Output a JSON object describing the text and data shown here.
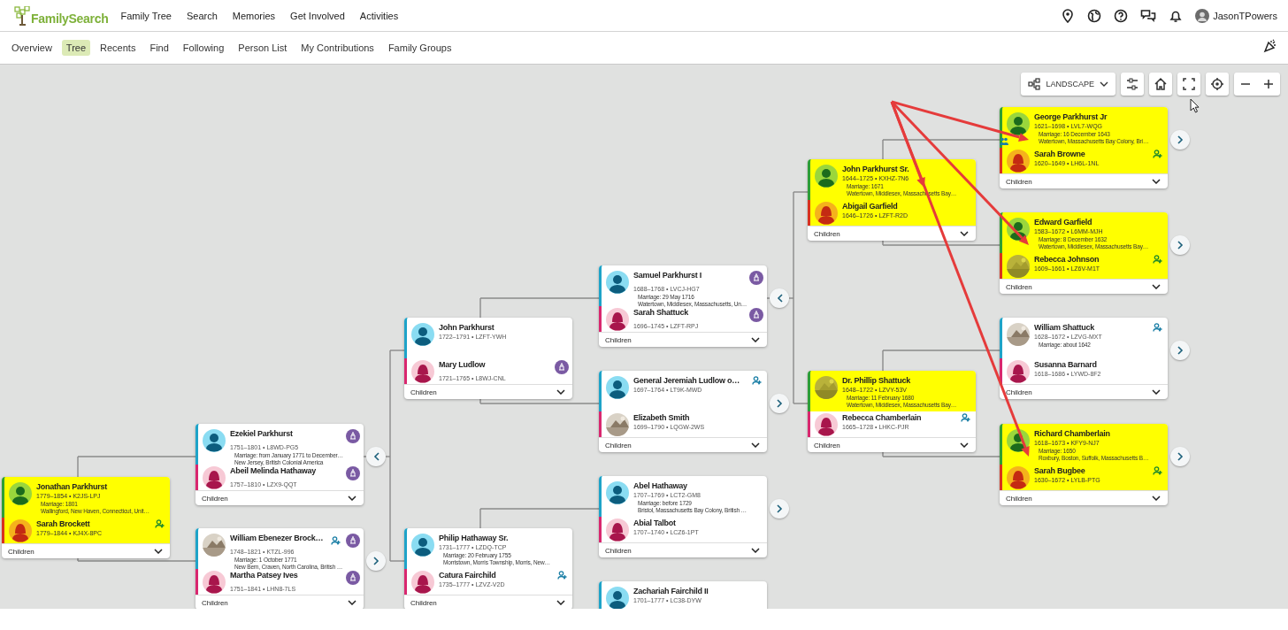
{
  "header": {
    "logo": "FamilySearch",
    "nav": [
      {
        "label": "Family Tree"
      },
      {
        "label": "Search"
      },
      {
        "label": "Memories"
      },
      {
        "label": "Get Involved"
      },
      {
        "label": "Activities"
      }
    ],
    "user": "JasonTPowers"
  },
  "subnav": [
    {
      "label": "Overview",
      "selected": false
    },
    {
      "label": "Tree",
      "selected": true
    },
    {
      "label": "Recents",
      "selected": false
    },
    {
      "label": "Find",
      "selected": false
    },
    {
      "label": "Following",
      "selected": false
    },
    {
      "label": "Person List",
      "selected": false
    },
    {
      "label": "My Contributions",
      "selected": false
    },
    {
      "label": "Family Groups",
      "selected": false
    }
  ],
  "toolbar": {
    "layout": "LANDSCAPE"
  },
  "tree": {
    "husband": {
      "name": "Jonathan Parkhurst",
      "dates": "1779–1854 • K2JS-LPJ",
      "kind": "male",
      "highlighted": true
    },
    "wife": {
      "name": "Sarah Brockett",
      "dates": "1779–1844 • KJ4X-8PC",
      "kind": "female",
      "highlighted": true,
      "relatives_icon": true
    },
    "marriage": {
      "date": "Marriage: 1801",
      "place": "Wallingford, New Haven, Connecticut, Unit…"
    },
    "children_label": "Children",
    "parents": [
      {
        "husband": {
          "name": "Ezekiel Parkhurst",
          "dates": "1751–1801 • L8WD-PG5",
          "kind": "male",
          "highlighted": false,
          "temple_icon": true
        },
        "wife": {
          "name": "Abeil Melinda Hathaway",
          "dates": "1757–1810 • LZX9-QQT",
          "kind": "female",
          "highlighted": false,
          "temple_icon": true
        },
        "marriage": {
          "date": "Marriage: from January 1771 to December…",
          "place": "New Jersey, British Colonial America"
        },
        "children_label": "Children",
        "collapse_button": true,
        "parents": [
          {
            "husband": {
              "name": "John Parkhurst",
              "dates": "1722–1791 • LZFT-YWH",
              "kind": "male",
              "highlighted": false
            },
            "wife": {
              "name": "Mary Ludlow",
              "dates": "1721–1765 • L8WJ-CNL",
              "kind": "female",
              "highlighted": false,
              "temple_icon": true
            },
            "children_label": "Children",
            "parents": [
              {
                "husband": {
                  "name": "Samuel Parkhurst I",
                  "dates": "1688–1768 • LVCJ-HG7",
                  "kind": "male",
                  "highlighted": false,
                  "temple_icon": true
                },
                "wife": {
                  "name": "Sarah Shattuck",
                  "dates": "1696–1745 • LZFT-RPJ",
                  "kind": "female",
                  "highlighted": false,
                  "temple_icon": true
                },
                "marriage": {
                  "date": "Marriage: 29 May 1716",
                  "place": "Watertown, Middlesex, Massachusetts, Un…"
                },
                "children_label": "Children",
                "collapse_button": true,
                "parents": [
                  {
                    "husband": {
                      "name": "John Parkhurst Sr.",
                      "dates": "1644–1725 • KXHZ-7N6",
                      "kind": "male",
                      "highlighted": true
                    },
                    "wife": {
                      "name": "Abigail Garfield",
                      "dates": "1646–1726 • LZFT-R2D",
                      "kind": "female",
                      "highlighted": true
                    },
                    "marriage": {
                      "date": "Marriage: 1671",
                      "place": "Watertown, Middlesex, Massachusetts Bay…"
                    },
                    "children_label": "Children",
                    "arrow": true,
                    "parents": [
                      {
                        "husband": {
                          "name": "George Parkhurst Jr",
                          "dates": "1621–1698 • LVL7-WQG",
                          "kind": "male",
                          "highlighted": true
                        },
                        "wife": {
                          "name": "Sarah Browne",
                          "dates": "1620–1649 • LH6L-1NL",
                          "kind": "female",
                          "highlighted": true,
                          "relatives_icon": true
                        },
                        "marriage": {
                          "date": "Marriage: 16 December 1643",
                          "place": "Watertown, Massachusetts Bay Colony, Bri…"
                        },
                        "children_label": "Children",
                        "expand_button": true,
                        "arrow": true,
                        "couple_icon": true
                      },
                      {
                        "husband": {
                          "name": "Edward Garfield",
                          "dates": "1583–1672 • L6MM-MJH",
                          "kind": "male",
                          "highlighted": true
                        },
                        "wife": {
                          "name": "Rebecca Johnson",
                          "dates": "1609–1661 • LZ6V-M1T",
                          "highlighted": true,
                          "relatives_icon": true
                        },
                        "marriage": {
                          "date": "Marriage: 8 December 1632",
                          "place": "Watertown, Middlesex, Massachusetts Bay…"
                        },
                        "children_label": "Children",
                        "expand_button": true,
                        "arrow": true
                      }
                    ]
                  },
                  {
                    "husband": {
                      "name": "Dr. Phillip Shattuck",
                      "dates": "1648–1722 • LZVY-53V",
                      "highlighted": true
                    },
                    "wife": {
                      "name": "Rebecca Chamberlain",
                      "dates": "1665–1728 • LHKC-PJR",
                      "kind": "female",
                      "highlighted": false,
                      "relatives_icon": true
                    },
                    "marriage": {
                      "date": "Marriage: 11 February 1680",
                      "place": "Watertown, Middlesex, Massachusetts Bay…"
                    },
                    "children_label": "Children",
                    "parents": [
                      {
                        "husband": {
                          "name": "William Shattuck",
                          "dates": "1628–1672 • LZVG-MXT",
                          "highlighted": false,
                          "relatives_icon": true
                        },
                        "wife": {
                          "name": "Susanna Barnard",
                          "dates": "1618–1686 • LYWD-8F2",
                          "kind": "female",
                          "highlighted": false
                        },
                        "marriage": {
                          "date": "Marriage: about 1642"
                        },
                        "children_label": "Children",
                        "expand_button": true
                      },
                      {
                        "husband": {
                          "name": "Richard Chamberlain",
                          "dates": "1618–1673 • KFY9-NJ7",
                          "kind": "male",
                          "highlighted": true
                        },
                        "wife": {
                          "name": "Sarah Bugbee",
                          "dates": "1630–1672 • LYLB-PTG",
                          "kind": "female",
                          "highlighted": true,
                          "relatives_icon": true
                        },
                        "marriage": {
                          "date": "Marriage: 1650",
                          "place": "Roxbury, Boston, Suffolk, Massachusetts B…"
                        },
                        "children_label": "Children",
                        "expand_button": true,
                        "arrow": true
                      }
                    ]
                  }
                ]
              },
              {
                "husband": {
                  "name": "General Jeremiah Ludlow o…",
                  "dates": "1697–1764 • LT9K-MWD",
                  "kind": "male",
                  "highlighted": false,
                  "relatives_icon": true
                },
                "wife": {
                  "name": "Elizabeth Smith",
                  "dates": "1699–1790 • LQGW-2WS",
                  "highlighted": false
                },
                "children_label": "Children",
                "expand_button": true
              }
            ]
          },
          {
            "husband": {
              "name": "Philip Hathaway Sr.",
              "dates": "1731–1777 • LZDQ-TCP",
              "kind": "male",
              "highlighted": false
            },
            "wife": {
              "name": "Catura Fairchild",
              "dates": "1735–1777 • LZVZ-V2D",
              "kind": "female",
              "highlighted": false,
              "relatives_icon": true
            },
            "marriage": {
              "date": "Marriage: 20 February 1755",
              "place": "Morristown, Morris Township, Morris, New…"
            },
            "children_label": "Children",
            "parents": [
              {
                "husband": {
                  "name": "Abel Hathaway",
                  "dates": "1707–1769 • LCT2-GM8",
                  "kind": "male",
                  "highlighted": false
                },
                "wife": {
                  "name": "Abial Talbot",
                  "dates": "1707–1740 • LCZ6-1PT",
                  "kind": "female",
                  "highlighted": false
                },
                "marriage": {
                  "date": "Marriage: before 1729",
                  "place": "Bristol, Massachusetts Bay Colony, British …"
                },
                "children_label": "Children",
                "expand_button": true
              },
              {
                "husband": {
                  "name": "Zachariah Fairchild II",
                  "dates": "1701–1777 • LC38-DYW",
                  "kind": "male",
                  "highlighted": false
                }
              }
            ]
          }
        ]
      },
      {
        "husband": {
          "name": "William Ebenezer Brock…",
          "dates": "1748–1821 • KTZL-996",
          "highlighted": false,
          "relatives_icon": true,
          "temple_icon": true
        },
        "wife": {
          "name": "Martha Patsey Ives",
          "dates": "1751–1841 • LHN8-7LS",
          "kind": "female",
          "highlighted": false,
          "temple_icon": true
        },
        "marriage": {
          "date": "Marriage: 1 October 1771",
          "place": "New Bern, Craven, North Carolina, British …"
        },
        "children_label": "Children",
        "expand_button": true
      }
    ]
  }
}
